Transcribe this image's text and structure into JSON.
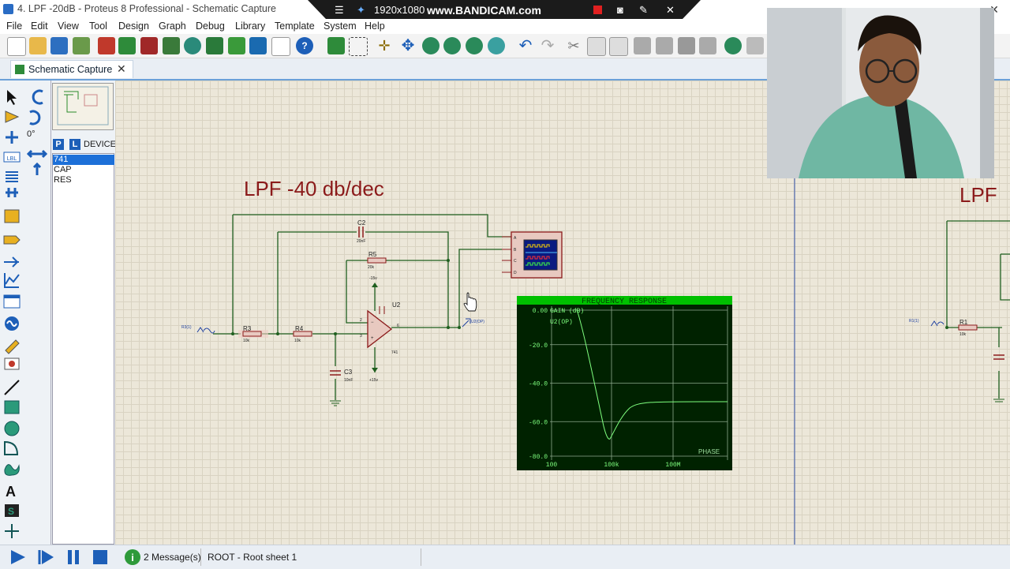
{
  "window": {
    "title": "4. LPF -20dB - Proteus 8 Professional - Schematic Capture"
  },
  "bandicam": {
    "resolution": "1920x1080",
    "brand": "www.BANDICAM.com"
  },
  "menu": [
    "File",
    "Edit",
    "View",
    "Tool",
    "Design",
    "Graph",
    "Debug",
    "Library",
    "Template",
    "System",
    "Help"
  ],
  "tabs": [
    {
      "label": "Schematic Capture"
    }
  ],
  "sidebar": {
    "angle": "0°",
    "pick_p": "P",
    "pick_l": "L",
    "devices_header": "DEVICES",
    "devices": [
      "741",
      "CAP",
      "RES"
    ],
    "selected": "741"
  },
  "schematic": {
    "title": "LPF -40 db/dec",
    "title_right": "LPF",
    "components": {
      "c2": {
        "ref": "C2",
        "value": "20nF"
      },
      "r5": {
        "ref": "R5",
        "value": "20k"
      },
      "u2": {
        "ref": "U2",
        "value": "741",
        "pin2": "2",
        "pin3": "3",
        "pin6": "6",
        "pin7": "7",
        "pin4": "4"
      },
      "r3": {
        "ref": "R3",
        "value": "10k"
      },
      "r4": {
        "ref": "R4",
        "value": "10k"
      },
      "c3": {
        "ref": "C3",
        "value": "10nF"
      },
      "r1": {
        "ref": "R1",
        "value": "10k"
      }
    },
    "supply_neg": "-15v",
    "supply_pos": "+15v",
    "source_left": "R3(1)",
    "source_right": "R1(1)",
    "probe": "U2(OP)",
    "scope_channels": [
      "A",
      "B",
      "C",
      "D"
    ]
  },
  "graph": {
    "title": "FREQUENCY RESPONSE",
    "legend": [
      "GAIN (dB)",
      "U2(OP)"
    ],
    "phase_label": "PHASE",
    "y_ticks": [
      "0.00",
      "-20.0",
      "-40.0",
      "-60.0",
      "-80.0"
    ],
    "x_ticks": [
      "100",
      "100k",
      "100M"
    ],
    "colors": {
      "background": "#002200",
      "header": "#00c000",
      "trace": "#7fff7f"
    }
  },
  "status": {
    "messages": "2 Message(s)",
    "sheet": "ROOT - Root sheet 1"
  }
}
